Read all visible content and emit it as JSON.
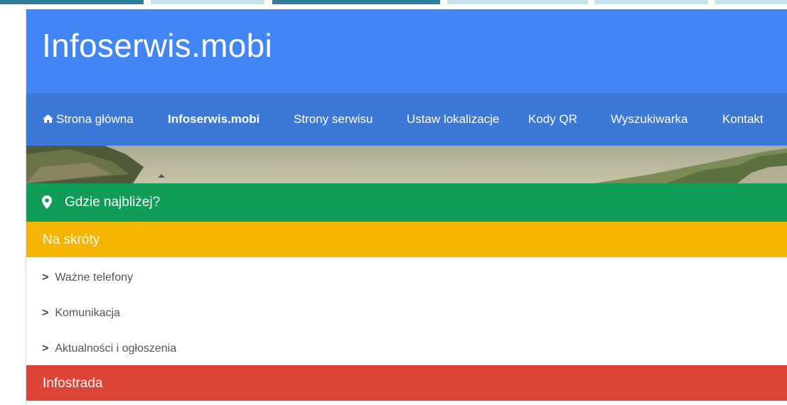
{
  "header": {
    "site_title": "Infoserwis.mobi"
  },
  "nav": {
    "items": [
      {
        "label": "Strona główna",
        "icon": "home-icon",
        "active": false
      },
      {
        "label": "Infoserwis.mobi",
        "active": true
      },
      {
        "label": "Strony serwisu",
        "active": false
      },
      {
        "label": "Ustaw lokalizacje",
        "active": false
      },
      {
        "label": "Kody QR",
        "active": false
      },
      {
        "label": "Wyszukiwarka",
        "active": false
      },
      {
        "label": "Kontakt",
        "active": false
      }
    ]
  },
  "nearest": {
    "label": "Gdzie najbliżej?",
    "icon": "map-marker-icon"
  },
  "shortcuts": {
    "title": "Na skróty",
    "links": [
      {
        "label": "Ważne telefony"
      },
      {
        "label": "Komunikacja"
      },
      {
        "label": "Aktualności i ogłoszenia"
      }
    ]
  },
  "infostrada": {
    "title": "Infostrada"
  },
  "colors": {
    "header_blue": "#4285f4",
    "nav_blue": "#3c78d8",
    "green": "#0f9d58",
    "yellow": "#f4b400",
    "red": "#db4437"
  }
}
